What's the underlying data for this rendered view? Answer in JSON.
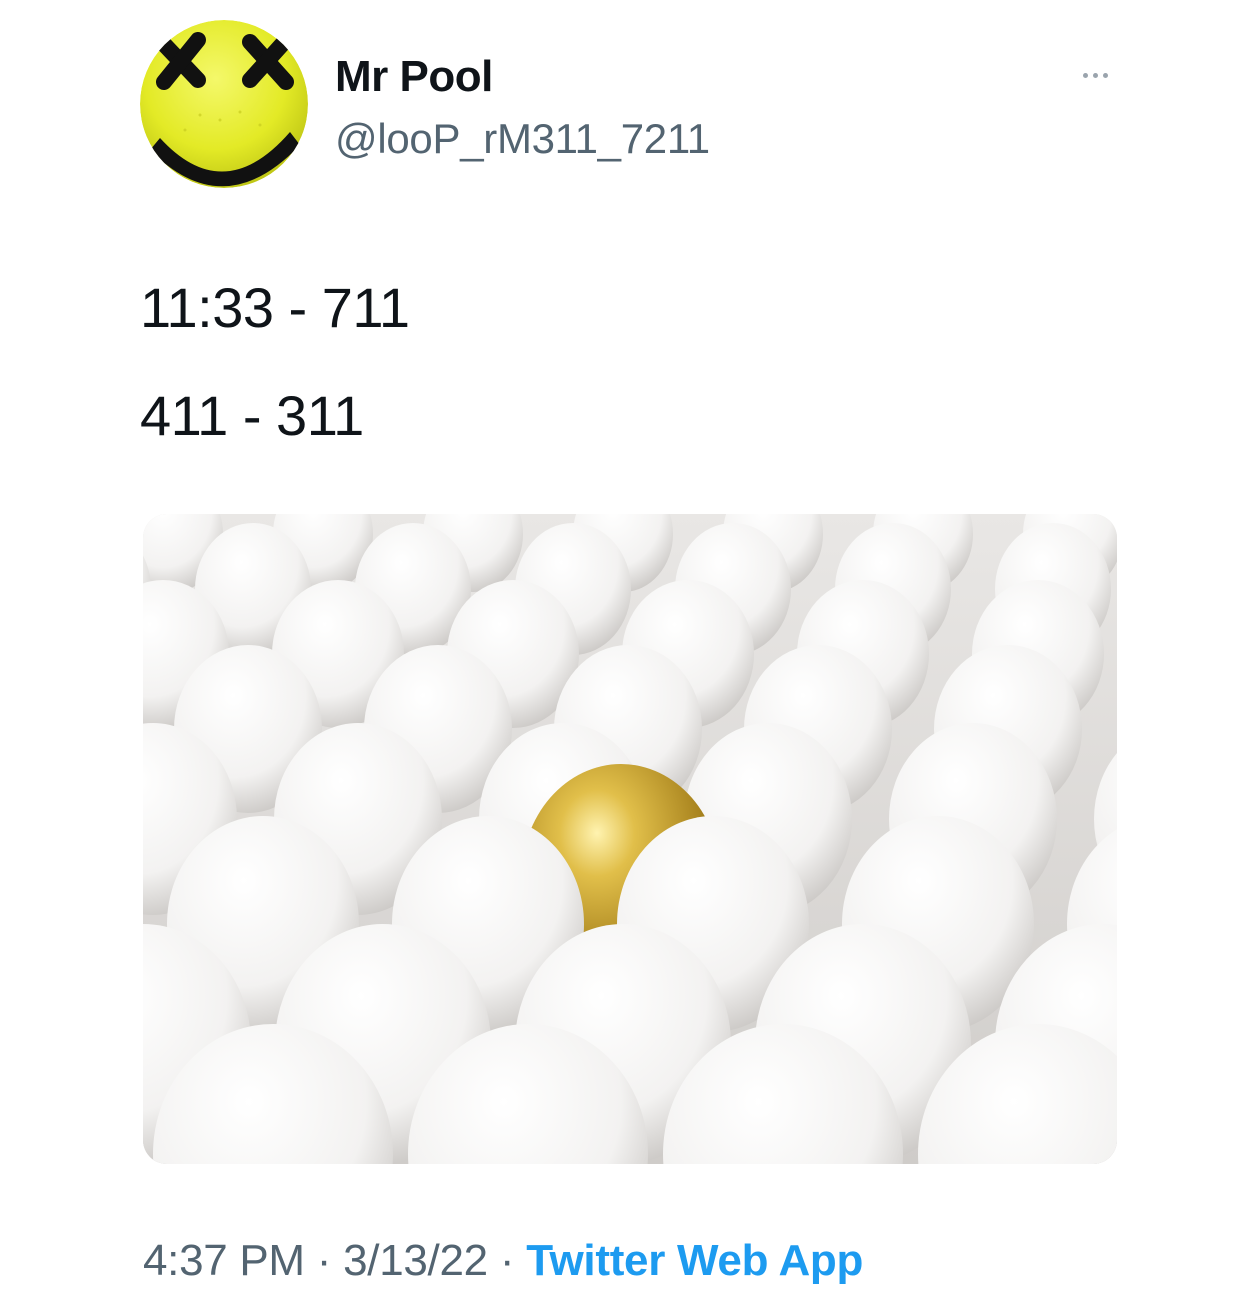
{
  "tweet": {
    "author": {
      "display_name": "Mr Pool",
      "handle": "@looP_rM311_7211",
      "avatar_icon": "yellow-smiley-x-eyes-avatar"
    },
    "more_icon": "more-dots-icon",
    "lines": [
      "11:33 - 711",
      "411 - 311"
    ],
    "media": {
      "description_icon": "golden-egg-among-white-eggs-image"
    },
    "meta": {
      "time": "4:37 PM",
      "separator": "·",
      "date": "3/13/22",
      "source": "Twitter Web App"
    }
  },
  "colors": {
    "text_primary": "#0f1419",
    "text_secondary": "#536471",
    "link": "#1d9bf0",
    "avatar_yellow": "#e6ee2a"
  }
}
